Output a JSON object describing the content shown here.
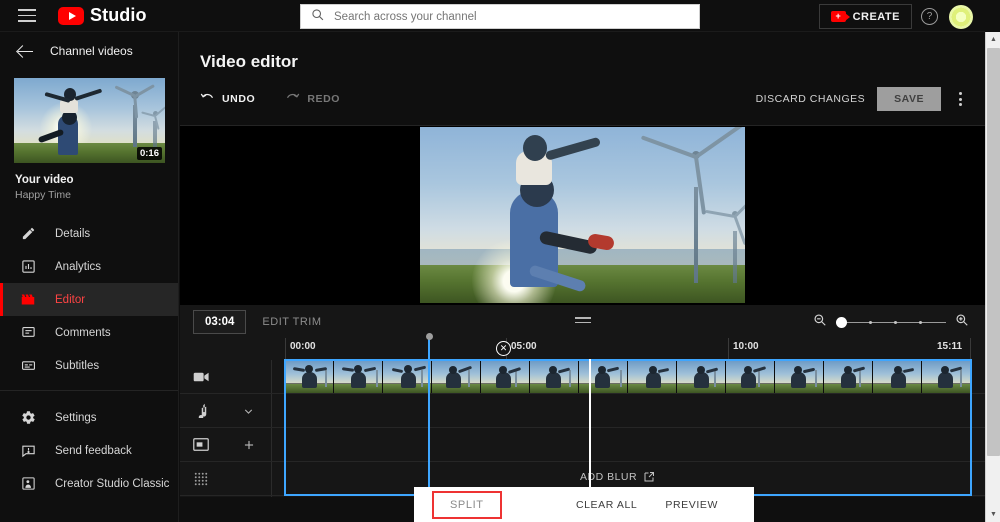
{
  "topbar": {
    "menu_icon": "hamburger-icon",
    "logo_text": "Studio",
    "search": {
      "placeholder": "Search across your channel",
      "value": "",
      "icon": "search-icon"
    },
    "create_label": "CREATE",
    "create_icon": "video-camera-plus-icon",
    "help_icon": "question-mark-icon",
    "avatar": "account-avatar"
  },
  "sidebar": {
    "back_label": "Channel videos",
    "back_icon": "arrow-left-icon",
    "thumbnail_duration": "0:16",
    "video_title": "Your video",
    "video_subtitle": "Happy Time",
    "items": [
      {
        "label": "Details",
        "icon": "pencil-icon",
        "active": false
      },
      {
        "label": "Analytics",
        "icon": "bar-chart-icon",
        "active": false
      },
      {
        "label": "Editor",
        "icon": "clapperboard-icon",
        "active": true
      },
      {
        "label": "Comments",
        "icon": "comment-icon",
        "active": false
      },
      {
        "label": "Subtitles",
        "icon": "subtitles-icon",
        "active": false
      }
    ],
    "bottom_items": [
      {
        "label": "Settings",
        "icon": "gear-icon"
      },
      {
        "label": "Send feedback",
        "icon": "feedback-icon"
      },
      {
        "label": "Creator Studio Classic",
        "icon": "creator-studio-classic-icon"
      }
    ]
  },
  "main": {
    "page_title": "Video editor",
    "undo_label": "UNDO",
    "redo_label": "REDO",
    "discard_label": "DISCARD CHANGES",
    "save_label": "SAVE",
    "more_icon": "kebab-menu-icon"
  },
  "timeline": {
    "current_time": "03:04",
    "edit_trim_label": "EDIT TRIM",
    "drag_handle_icon": "drag-handle-icon",
    "zoom_out_icon": "zoom-out-icon",
    "zoom_in_icon": "zoom-in-icon",
    "zoom_value": 0,
    "ruler_labels": [
      "00:00",
      "05:00",
      "10:00",
      "15:11"
    ],
    "close_marker_icon": "close-circle-icon",
    "tracks": [
      {
        "icon": "video-track-icon",
        "action": "",
        "action_icon": ""
      },
      {
        "icon": "audio-note-icon",
        "action": "",
        "action_icon": "chevron-down-icon"
      },
      {
        "icon": "end-screen-icon",
        "action": "",
        "action_icon": "plus-icon"
      },
      {
        "icon": "blur-grid-icon",
        "action": "ADD BLUR",
        "action_icon": "external-link-icon"
      }
    ],
    "add_blur_label": "ADD BLUR"
  },
  "popup_bar": {
    "split_label": "SPLIT",
    "clear_all_label": "CLEAR ALL",
    "preview_label": "PREVIEW",
    "highlight_color": "#ee3333"
  },
  "colors": {
    "brand_red": "#ff0000",
    "accent_blue": "#3ea6ff",
    "background": "#0f0f0f",
    "panel": "#161616"
  },
  "chart_data": null
}
